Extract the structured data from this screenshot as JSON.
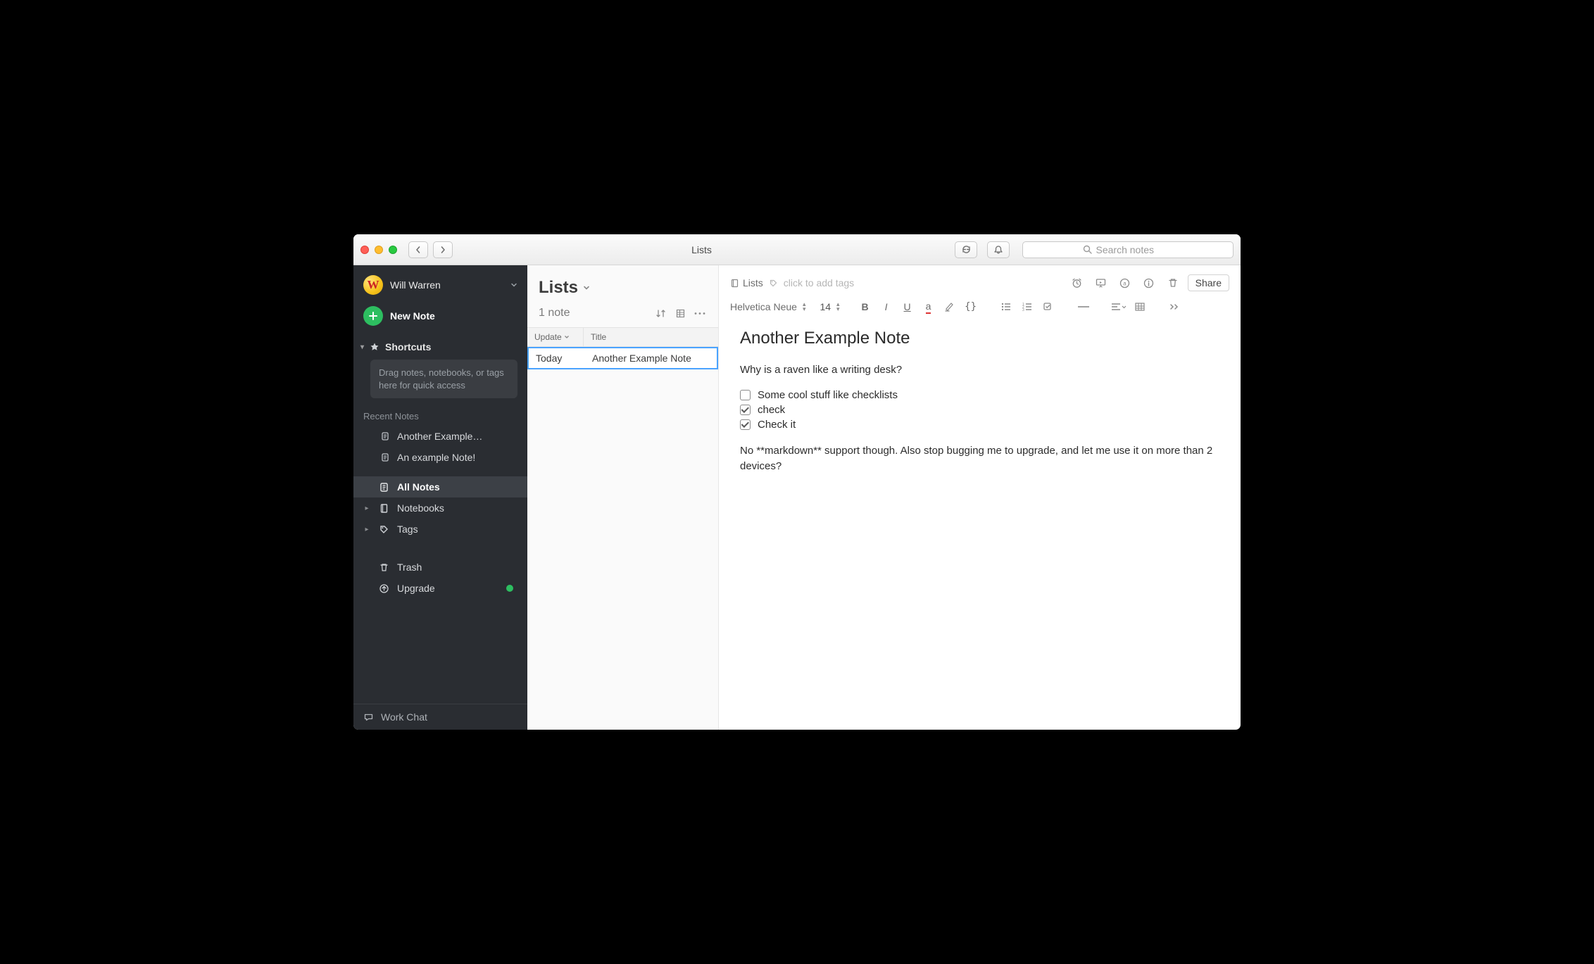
{
  "window": {
    "title": "Lists"
  },
  "search": {
    "placeholder": "Search notes"
  },
  "sidebar": {
    "user": "Will Warren",
    "new_note": "New Note",
    "shortcuts_label": "Shortcuts",
    "shortcuts_hint": "Drag notes, notebooks, or tags here for quick access",
    "recent_label": "Recent Notes",
    "recent": [
      "Another Example…",
      "An example Note!"
    ],
    "all_notes": "All Notes",
    "notebooks": "Notebooks",
    "tags": "Tags",
    "trash": "Trash",
    "upgrade": "Upgrade",
    "work_chat": "Work Chat"
  },
  "list": {
    "heading": "Lists",
    "count": "1 note",
    "cols": {
      "update": "Update",
      "title": "Title"
    },
    "rows": [
      {
        "update": "Today",
        "title": "Another Example Note"
      }
    ]
  },
  "note": {
    "notebook": "Lists",
    "tag_placeholder": "click to add tags",
    "share": "Share",
    "font": "Helvetica Neue",
    "font_size": "14",
    "title": "Another Example Note",
    "paragraph1": "Why is a raven like a writing desk?",
    "checklist": [
      {
        "text": "Some cool stuff like checklists",
        "checked": false
      },
      {
        "text": "check",
        "checked": true
      },
      {
        "text": "Check it",
        "checked": true
      }
    ],
    "paragraph2": "No **markdown** support though. Also stop bugging me to upgrade, and let me use it on more than 2 devices?"
  }
}
